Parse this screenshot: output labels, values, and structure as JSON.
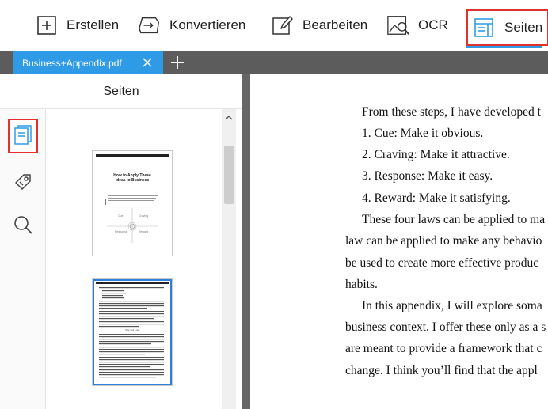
{
  "toolbar": {
    "items": [
      {
        "label": "Erstellen",
        "icon": "plus-square-icon"
      },
      {
        "label": "Konvertieren",
        "icon": "convert-icon"
      },
      {
        "label": "Bearbeiten",
        "icon": "edit-icon"
      },
      {
        "label": "OCR",
        "icon": "ocr-icon"
      },
      {
        "label": "Seiten",
        "icon": "pages-icon",
        "active": true
      }
    ]
  },
  "tabs": {
    "active": {
      "label": "Business+Appendix.pdf"
    }
  },
  "sidepanel": {
    "title": "Seiten",
    "rail": [
      "pages-icon",
      "tag-icon",
      "search-icon"
    ]
  },
  "thumbnails": {
    "page1": {
      "title_line1": "How to Apply These",
      "title_line2": "Ideas to Business",
      "quad_labels": [
        "Cue",
        "Craving",
        "Response",
        "Reward"
      ]
    },
    "page2": {
      "heading": "The 3rd Law"
    }
  },
  "document": {
    "lines": [
      "From these steps, I have developed t",
      "1.    Cue: Make it obvious.",
      "2.    Craving: Make it attractive.",
      "3.    Response: Make it easy.",
      "4.    Reward: Make it satisfying.",
      "These four laws can be applied to ma",
      "law can be applied to make any behavio",
      "be used to create more effective produc",
      "habits.",
      "In this appendix, I will explore soma",
      "business context. I offer these only as a s",
      "are meant to provide a framework that c",
      "change. I think you’ll find that the appl"
    ]
  },
  "colors": {
    "accent": "#2f9be6",
    "highlight": "#e03131",
    "tabbar": "#5c5c5c",
    "viewer_bg": "#666666"
  }
}
